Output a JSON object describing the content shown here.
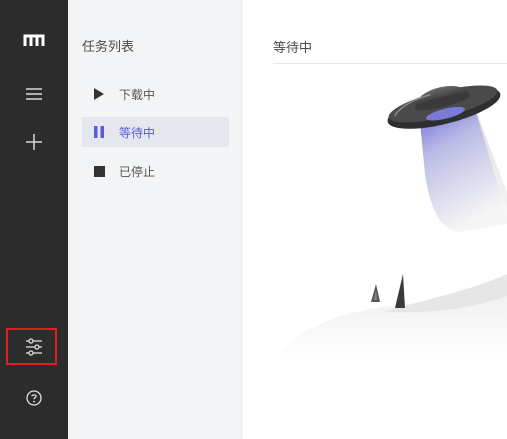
{
  "rail": {
    "items": [
      {
        "name": "logo",
        "icon": "logo-icon"
      },
      {
        "name": "task-list",
        "icon": "menu-icon"
      },
      {
        "name": "add-task",
        "icon": "plus-icon"
      },
      {
        "name": "preferences",
        "icon": "sliders-icon",
        "highlighted": true
      },
      {
        "name": "help",
        "icon": "help-circle-icon"
      }
    ],
    "highlight_color": "#e02020"
  },
  "task_panel": {
    "title": "任务列表",
    "items": [
      {
        "label": "下载中",
        "icon": "play-icon",
        "active": false
      },
      {
        "label": "等待中",
        "icon": "pause-icon",
        "active": true
      },
      {
        "label": "已停止",
        "icon": "stop-icon",
        "active": false
      }
    ],
    "accent_color": "#5b5bd6"
  },
  "main": {
    "title": "等待中",
    "empty_illustration": "ufo-illustration"
  }
}
